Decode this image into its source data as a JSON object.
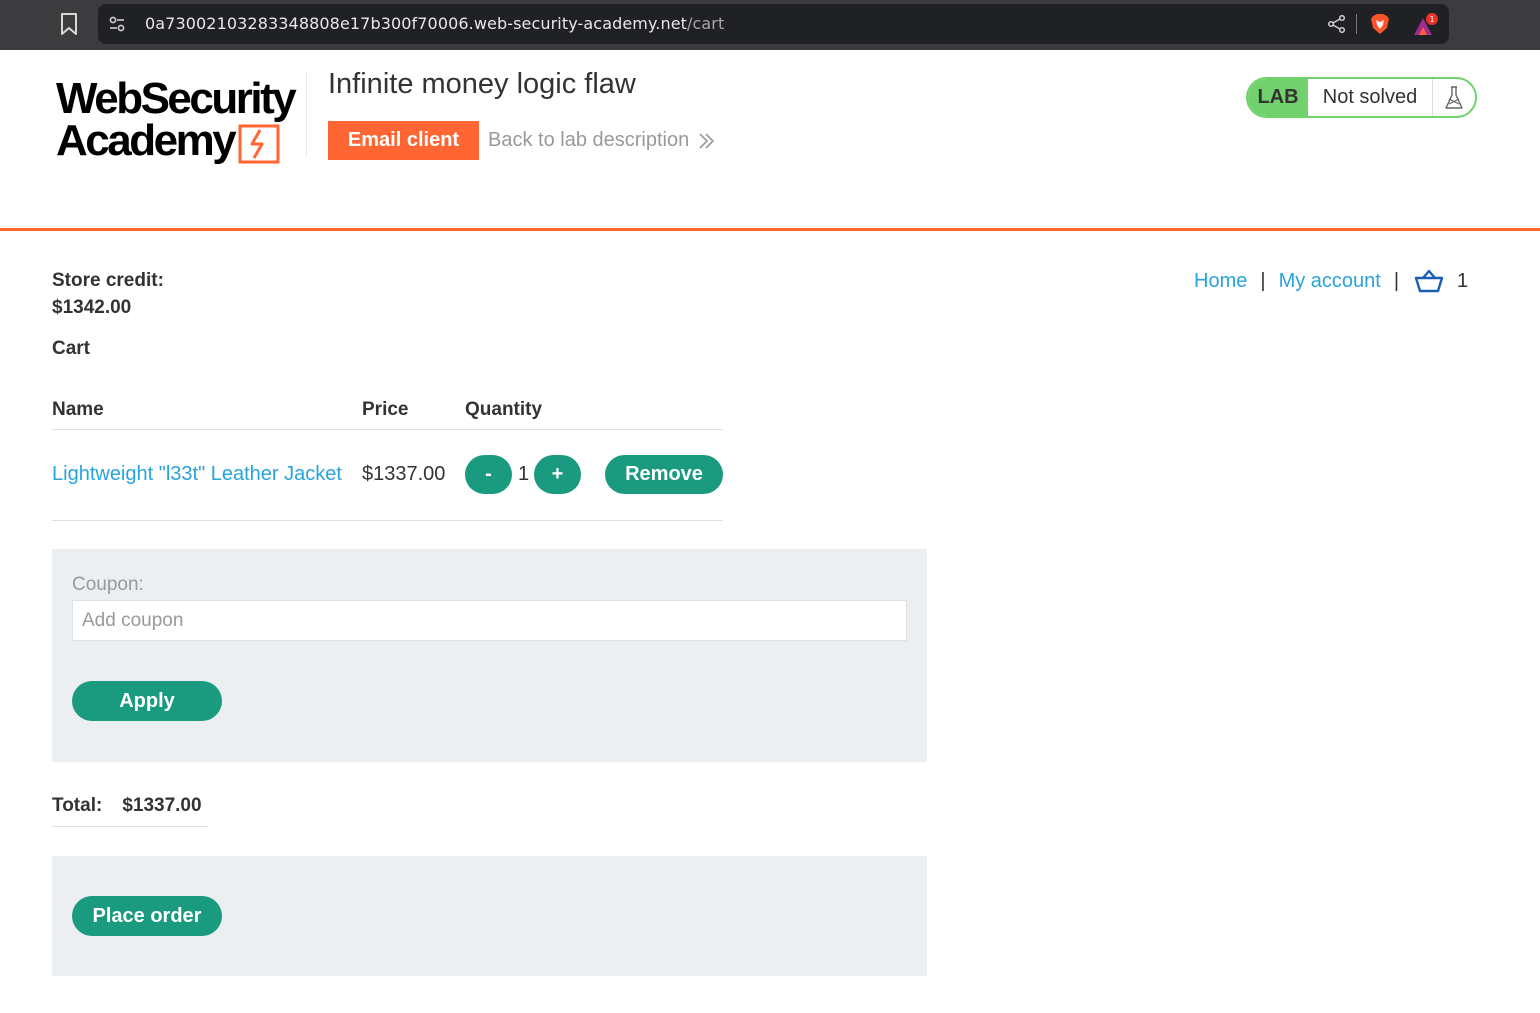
{
  "browser": {
    "url_host": "0a73002103283348808e17b300f70006.web-security-academy.net",
    "url_path": "/cart",
    "notification_count": "1"
  },
  "header": {
    "logo_line1": "WebSecurity",
    "logo_line2": "Academy",
    "lab_title": "Infinite money logic flaw",
    "email_client_label": "Email client",
    "back_link_label": "Back to lab description",
    "lab_badge": "LAB",
    "lab_status": "Not solved"
  },
  "nav": {
    "home": "Home",
    "separator": "|",
    "my_account": "My account",
    "cart_count": "1"
  },
  "store_credit": {
    "label": "Store credit:",
    "value": "$1342.00"
  },
  "cart": {
    "heading": "Cart",
    "columns": {
      "name": "Name",
      "price": "Price",
      "quantity": "Quantity"
    },
    "items": [
      {
        "name": "Lightweight \"l33t\" Leather Jacket",
        "price": "$1337.00",
        "quantity": "1",
        "decrement_label": "-",
        "increment_label": "+",
        "remove_label": "Remove"
      }
    ]
  },
  "coupon": {
    "label": "Coupon:",
    "placeholder": "Add coupon",
    "value": "",
    "apply_label": "Apply"
  },
  "total": {
    "label": "Total:",
    "value": "$1337.00"
  },
  "place_order_label": "Place order",
  "colors": {
    "accent_orange": "#ff6633",
    "button_green": "#1a9b80",
    "link_blue": "#29a3dc",
    "lab_green": "#70d16d",
    "panel_gray": "#ebeff1"
  },
  "icons": {
    "bookmark": "bookmark-icon",
    "site_settings": "tune-icon",
    "share": "share-icon",
    "brave_shield": "brave-shield-icon",
    "rewards": "brave-rewards-icon",
    "back_chevron": "double-chevron-right-icon",
    "lab_flask": "flask-icon",
    "basket": "basket-icon"
  }
}
